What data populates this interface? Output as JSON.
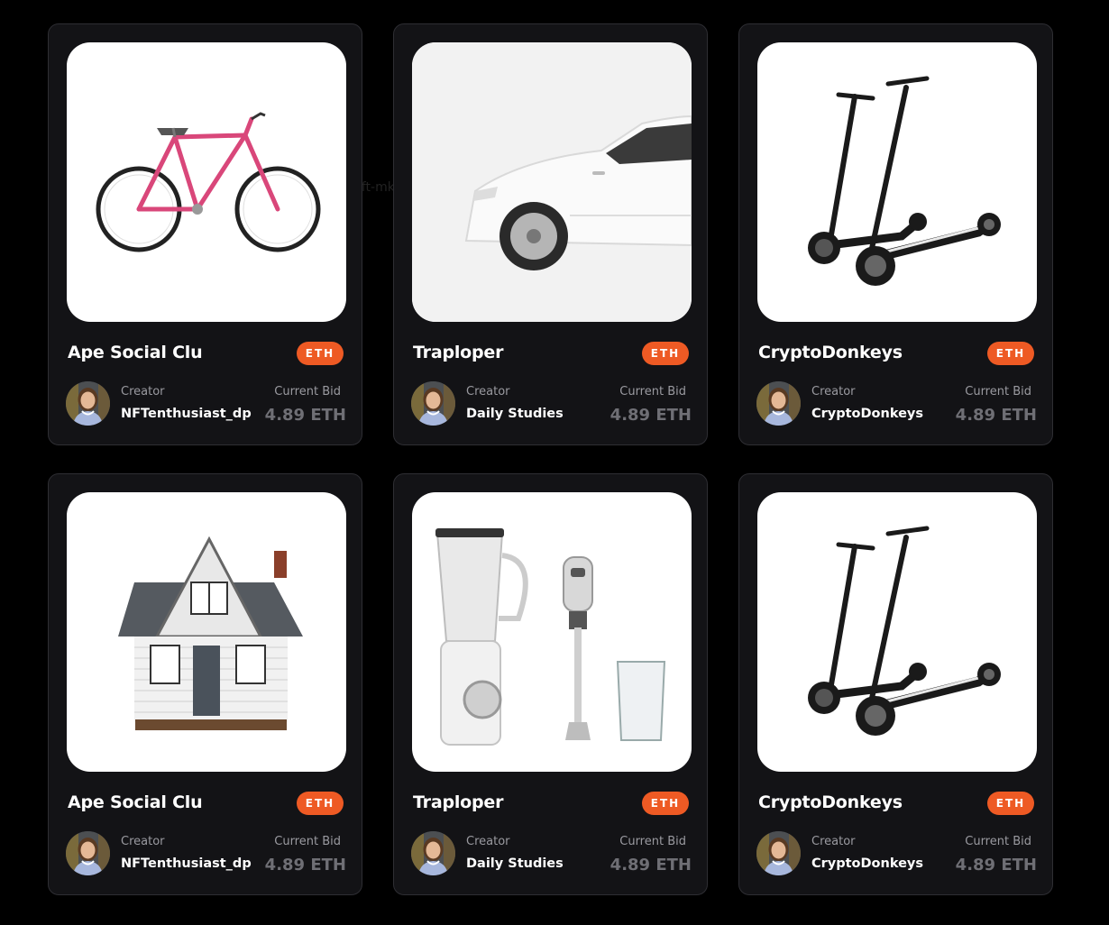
{
  "stray_text": "nft-mktplac",
  "cards": [
    {
      "title": "Ape Social Clu",
      "badge": "ETH",
      "creator_label": "Creator",
      "creator_name": "NFTenthusiast_dp",
      "bid_label": "Current Bid",
      "bid_value": "4.89 ETH",
      "image": "bicycle"
    },
    {
      "title": "Traploper",
      "badge": "ETH",
      "creator_label": "Creator",
      "creator_name": "Daily Studies",
      "bid_label": "Current Bid",
      "bid_value": "4.89 ETH",
      "image": "car"
    },
    {
      "title": "CryptoDonkeys",
      "badge": "ETH",
      "creator_label": "Creator",
      "creator_name": "CryptoDonkeys",
      "bid_label": "Current Bid",
      "bid_value": "4.89 ETH",
      "image": "scooters"
    },
    {
      "title": "Ape Social Clu",
      "badge": "ETH",
      "creator_label": "Creator",
      "creator_name": "NFTenthusiast_dp",
      "bid_label": "Current Bid",
      "bid_value": "4.89 ETH",
      "image": "house"
    },
    {
      "title": "Traploper",
      "badge": "ETH",
      "creator_label": "Creator",
      "creator_name": "Daily Studies",
      "bid_label": "Current Bid",
      "bid_value": "4.89 ETH",
      "image": "blender"
    },
    {
      "title": "CryptoDonkeys",
      "badge": "ETH",
      "creator_label": "Creator",
      "creator_name": "CryptoDonkeys",
      "bid_label": "Current Bid",
      "bid_value": "4.89 ETH",
      "image": "scooters"
    }
  ],
  "colors": {
    "background": "#000000",
    "card": "#131316",
    "accent": "#ee5a24",
    "muted": "#9a9aa0"
  }
}
